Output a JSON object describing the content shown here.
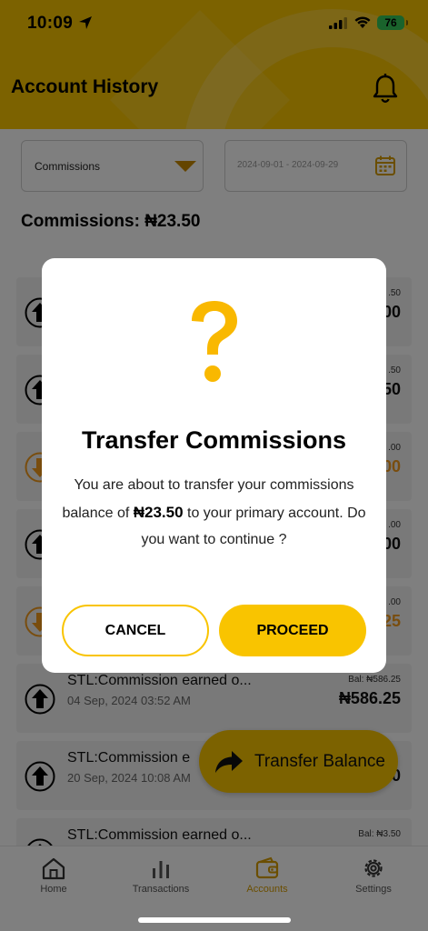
{
  "status_bar": {
    "time": "10:09",
    "battery": "76"
  },
  "header": {
    "title": "Account History"
  },
  "filters": {
    "type_selected": "Commissions",
    "date_range": "2024-09-01 - 2024-09-29"
  },
  "summary": {
    "label": "Commissions: ₦23.50"
  },
  "transactions": [
    {
      "title": "",
      "date": "",
      "bal": ".50",
      "amount": "00",
      "kind": "credit"
    },
    {
      "title": "",
      "date": "",
      "bal": ".50",
      "amount": "50",
      "kind": "credit"
    },
    {
      "title": "",
      "date": "",
      "bal": ".00",
      "amount": "00",
      "kind": "debit"
    },
    {
      "title": "",
      "date": "",
      "bal": ".00",
      "amount": "00",
      "kind": "credit"
    },
    {
      "title": "",
      "date": "",
      "bal": ".00",
      "amount": "25",
      "kind": "debit"
    },
    {
      "title": "STL:Commission earned o...",
      "date": "04 Sep, 2024 03:52 AM",
      "bal": "Bal: ₦586.25",
      "amount": "₦586.25",
      "kind": "credit"
    },
    {
      "title": "STL:Commission e",
      "date": "20 Sep, 2024 10:08 AM",
      "bal": "",
      "amount": "0",
      "kind": "credit"
    },
    {
      "title": "STL:Commission earned o...",
      "date": "",
      "bal": "Bal: ₦3.50",
      "amount": "",
      "kind": "credit"
    }
  ],
  "fab": {
    "label": "Transfer Balance"
  },
  "bottom_nav": {
    "items": [
      {
        "label": "Home",
        "icon": "home-icon"
      },
      {
        "label": "Transactions",
        "icon": "bar-chart-icon"
      },
      {
        "label": "Accounts",
        "icon": "wallet-icon"
      },
      {
        "label": "Settings",
        "icon": "gear-icon"
      }
    ],
    "active": "Accounts"
  },
  "dialog": {
    "icon": "question-mark-icon",
    "title": "Transfer Commissions",
    "message_before": "You are about to transfer your commissions balance of ",
    "message_amount": "₦23.50",
    "message_after": " to your primary account. Do you want to continue ?",
    "cancel_label": "CANCEL",
    "proceed_label": "PROCEED"
  },
  "colors": {
    "brand_yellow": "#f9c400",
    "accent_orange": "#d69c00",
    "debit_orange": "#f29a1c",
    "battery_green": "#34c759",
    "overlay": "rgba(0,0,0,0.5)"
  }
}
